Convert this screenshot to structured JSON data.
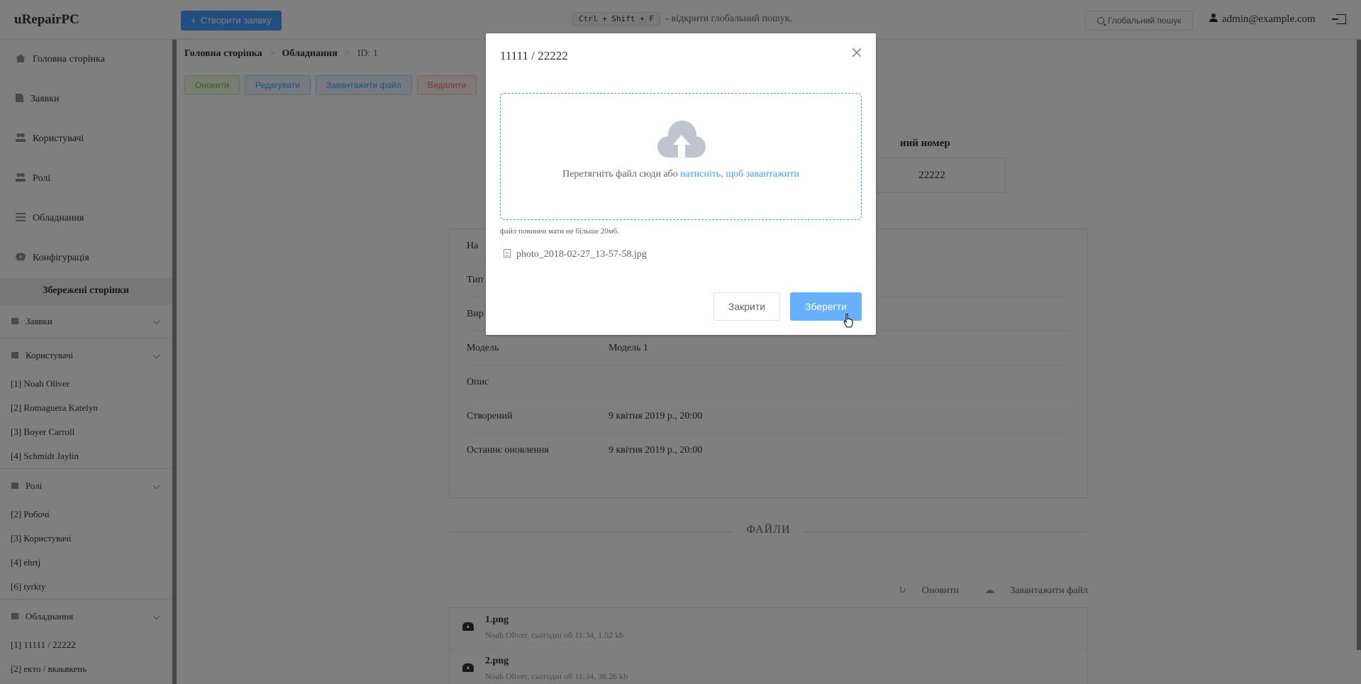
{
  "app": {
    "brand": "uRepairPC"
  },
  "topbar": {
    "create_label": "Створити заявку",
    "shortcut": "Ctrl + Shift + F",
    "shortcut_hint": "- відкрити глобальний пошук.",
    "search_label": "Глобальний пошук",
    "user_email": "admin@example.com"
  },
  "sidebar": {
    "items": [
      {
        "label": "Головна сторінка",
        "icon": "home-icon"
      },
      {
        "label": "Заявки",
        "icon": "document-icon"
      },
      {
        "label": "Користувачі",
        "icon": "users-icon"
      },
      {
        "label": "Ролі",
        "icon": "roles-icon"
      },
      {
        "label": "Обладнання",
        "icon": "list-icon"
      },
      {
        "label": "Конфігурація",
        "icon": "gear-icon"
      }
    ],
    "saved_title": "Збережені сторінки",
    "groups": [
      {
        "title": "Заявки",
        "items": []
      },
      {
        "title": "Користувачі",
        "items": [
          "[1] Noah Oliver",
          "[2] Romaguera Katelyn",
          "[3] Boyer Carroll",
          "[4] Schmidt Jaylin"
        ]
      },
      {
        "title": "Ролі",
        "items": [
          "[2] Робочі",
          "[3] Користувачі",
          "[4] ehrtj",
          "[6] tyrkty"
        ]
      },
      {
        "title": "Обладнання",
        "items": [
          "[1] 11111 / 22222",
          "[2] екто / вкаьвкень"
        ]
      }
    ]
  },
  "breadcrumb": {
    "home": "Головна сторінка",
    "section": "Обладнання",
    "current": "ID: 1"
  },
  "actions": {
    "refresh": "Оновити",
    "edit": "Редагувати",
    "upload": "Завантажити файл",
    "delete": "Видалити"
  },
  "serial": {
    "label": "ний номер",
    "value": "22222"
  },
  "details": [
    {
      "label": "На",
      "value": ""
    },
    {
      "label": "Тип",
      "value": ""
    },
    {
      "label": "Вир",
      "value": ""
    },
    {
      "label": "Модель",
      "value": "Модель 1"
    },
    {
      "label": "Опис",
      "value": ""
    },
    {
      "label": "Створений",
      "value": "9 квітня 2019 р., 20:00"
    },
    {
      "label": "Останнє оновлення",
      "value": "9 квітня 2019 р., 20:00"
    }
  ],
  "files": {
    "title": "ФАЙЛИ",
    "refresh": "Оновити",
    "upload": "Завантажити файл",
    "list": [
      {
        "name": "1.png",
        "meta": "Noah Oliver, сьогодні об 11:34, 1.52 kb"
      },
      {
        "name": "2.png",
        "meta": "Noah Oliver, сьогодні об 11:34, 38.26 kb"
      }
    ]
  },
  "modal": {
    "title": "11111 / 22222",
    "drop_text": "Перетягніть файл сюди або ",
    "drop_link": "натисніть, щоб завантажити",
    "tip": "файл повинен мати не більше 20мб.",
    "uploaded_file": "photo_2018-02-27_13-57-58.jpg",
    "close_label": "Закрити",
    "save_label": "Зберегти"
  }
}
